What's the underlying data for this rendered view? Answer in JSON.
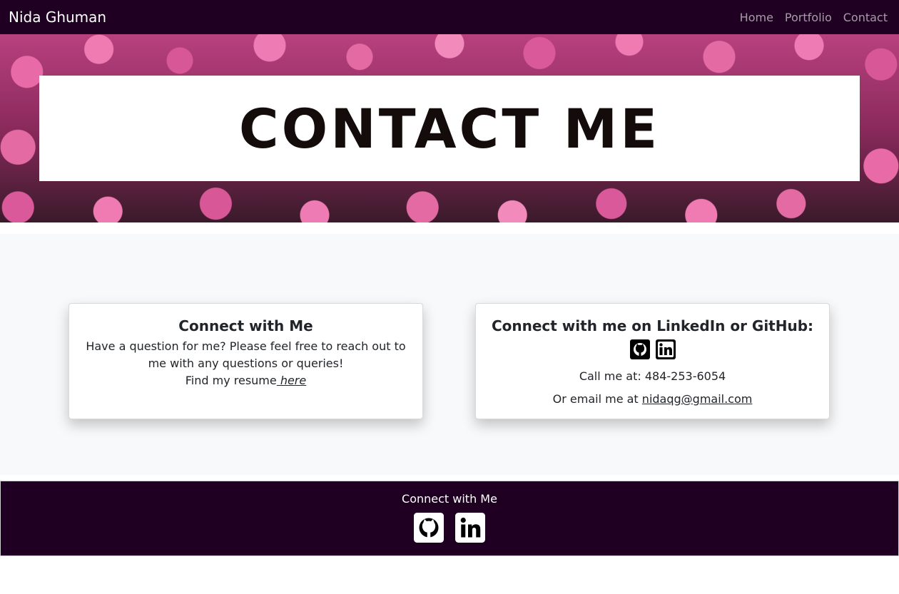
{
  "navbar": {
    "brand": "Nida Ghuman",
    "links": [
      "Home",
      "Portfolio",
      "Contact"
    ]
  },
  "hero": {
    "title": "CONTACT ME"
  },
  "connect_card": {
    "title": "Connect with Me",
    "text": "Have a question for me? Please feel free to reach out to me with any questions or queries!",
    "resume_prefix": "Find my resume",
    "resume_link": " here"
  },
  "social_card": {
    "title": "Connect with me on LinkedIn or GitHub:",
    "icons": [
      "github-icon",
      "linkedin-icon"
    ],
    "phone_prefix": "Call me at: ",
    "phone": "484-253-6054",
    "email_prefix": "Or email me at ",
    "email": "nidaqg@gmail.com"
  },
  "footer": {
    "title": "Connect with Me",
    "icons": [
      "github-icon",
      "linkedin-icon"
    ]
  },
  "colors": {
    "navbar_bg": "#1f0022",
    "footer_bg": "#1f0022",
    "main_bg": "#f8f9fa"
  }
}
